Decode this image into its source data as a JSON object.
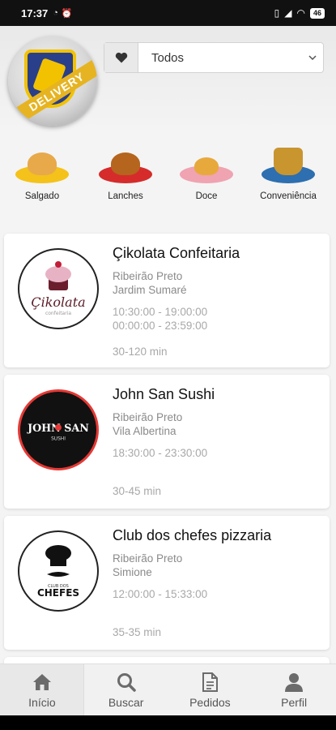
{
  "status_bar": {
    "time": "17:37",
    "battery": "46"
  },
  "brand": {
    "logo_text": "DELIVERY"
  },
  "filter": {
    "selected": "Todos"
  },
  "categories": [
    {
      "label": "Salgado"
    },
    {
      "label": "Lanches"
    },
    {
      "label": "Doce"
    },
    {
      "label": "Conveniência"
    }
  ],
  "restaurants": [
    {
      "name": "Çikolata Confeitaria",
      "city": "Ribeirão Preto",
      "district": "Jardim Sumaré",
      "hours_1": "10:30:00 - 19:00:00",
      "hours_2": "00:00:00 - 23:59:00",
      "eta": "30-120 min",
      "logo_text": "Çikolata",
      "logo_sub": "confeitaria"
    },
    {
      "name": "John San Sushi",
      "city": "Ribeirão Preto",
      "district": "Vila Albertina",
      "hours_1": "18:30:00 - 23:30:00",
      "hours_2": "",
      "eta": "30-45 min",
      "logo_text": "JOHN SAN",
      "logo_sub": "SUSHI"
    },
    {
      "name": "Club dos chefes pizzaria",
      "city": "Ribeirão Preto",
      "district": "Simione",
      "hours_1": "12:00:00 - 15:33:00",
      "hours_2": "",
      "eta": "35-35 min",
      "logo_text": "CHEFES",
      "logo_sub": "CLUB DOS"
    }
  ],
  "tabs": [
    {
      "label": "Início",
      "icon": "home-icon"
    },
    {
      "label": "Buscar",
      "icon": "search-icon"
    },
    {
      "label": "Pedidos",
      "icon": "document-icon"
    },
    {
      "label": "Perfil",
      "icon": "user-icon"
    }
  ]
}
